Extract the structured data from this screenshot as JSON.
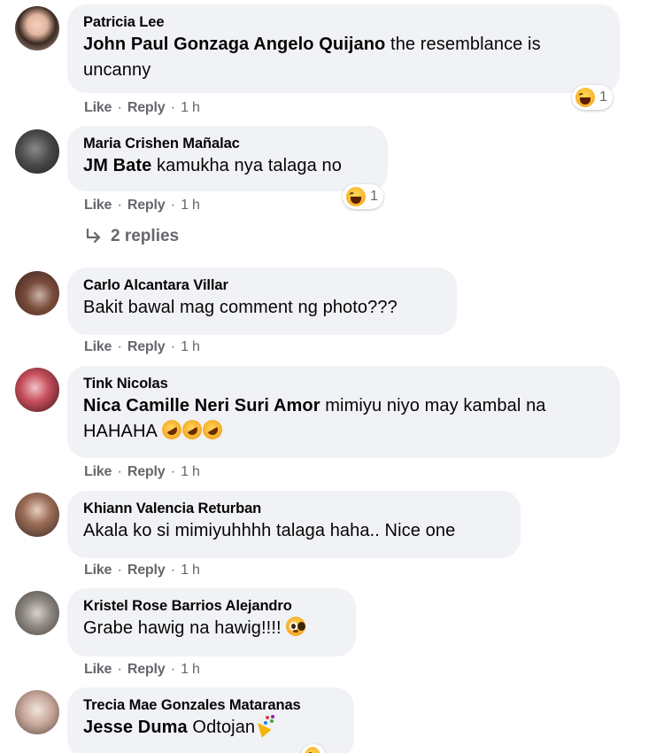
{
  "comments": [
    {
      "author": "Patricia Lee",
      "mention": "John Paul Gonzaga Angelo Quijano",
      "text_line1": " the resemblance is",
      "text_line2": "uncanny",
      "like": "Like",
      "reply": "Reply",
      "time": "1 h",
      "reaction": {
        "icon": "haha-icon",
        "count": "1"
      }
    },
    {
      "author": "Maria Crishen Mañalac",
      "mention": "JM Bate",
      "text": " kamukha nya talaga no",
      "like": "Like",
      "reply": "Reply",
      "time": "1 h",
      "reaction": {
        "icon": "haha-icon",
        "count": "1"
      },
      "replies_label": "2 replies"
    },
    {
      "author": "Carlo Alcantara Villar",
      "text": "Bakit bawal mag comment ng photo???",
      "like": "Like",
      "reply": "Reply",
      "time": "1 h"
    },
    {
      "author": "Tink Nicolas",
      "mention": "Nica Camille Neri Suri Amor",
      "text_line1": " mimiyu niyo may kambal na",
      "text_line2": "HAHAHA ",
      "like": "Like",
      "reply": "Reply",
      "time": "1 h"
    },
    {
      "author": "Khiann Valencia Returban",
      "text": "Akala ko si mimiyuhhhh talaga haha.. Nice one",
      "like": "Like",
      "reply": "Reply",
      "time": "1 h"
    },
    {
      "author": "Kristel Rose Barrios Alejandro",
      "text": "Grabe hawig na hawig!!!! ",
      "like": "Like",
      "reply": "Reply",
      "time": "1 h"
    },
    {
      "author": "Trecia Mae Gonzales Mataranas",
      "mention": "Jesse Duma",
      "text": " Odtojan"
    }
  ],
  "separator": "·",
  "colors": {
    "bubble": "#f0f2f5",
    "meta": "#65676b",
    "text": "#050505"
  }
}
